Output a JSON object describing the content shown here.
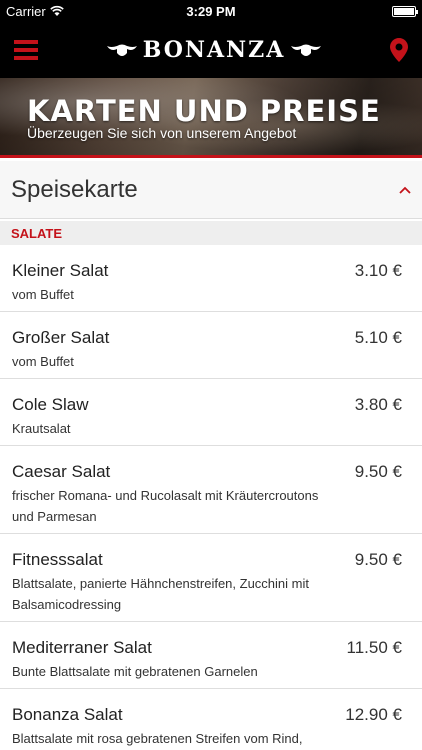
{
  "status_bar": {
    "carrier": "Carrier",
    "time": "3:29 PM"
  },
  "brand": {
    "logo_text": "BONANZA",
    "accent_color": "#c4121a"
  },
  "banner": {
    "title": "KARTEN UND PREISE",
    "subtitle": "Überzeugen Sie sich von unserem Angebot"
  },
  "section": {
    "title": "Speisekarte"
  },
  "category": {
    "label": "SALATE"
  },
  "items": [
    {
      "name": "Kleiner Salat",
      "price": "3.10 €",
      "description": "vom Buffet"
    },
    {
      "name": "Großer Salat",
      "price": "5.10 €",
      "description": "vom Buffet"
    },
    {
      "name": "Cole Slaw",
      "price": "3.80 €",
      "description": "Krautsalat"
    },
    {
      "name": "Caesar Salat",
      "price": "9.50 €",
      "description": "frischer Romana- und Rucolasalt mit Kräutercroutons und Parmesan"
    },
    {
      "name": "Fitnesssalat",
      "price": "9.50 €",
      "description": "Blattsalate, panierte Hähnchenstreifen, Zucchini mit Balsamicodressing"
    },
    {
      "name": "Mediterraner Salat",
      "price": "11.50 €",
      "description": "Bunte Blattsalate mit gebratenen Garnelen"
    },
    {
      "name": "Bonanza Salat",
      "price": "12.90 €",
      "description": "Blattsalate mit rosa gebratenen Streifen vom Rind,"
    }
  ]
}
